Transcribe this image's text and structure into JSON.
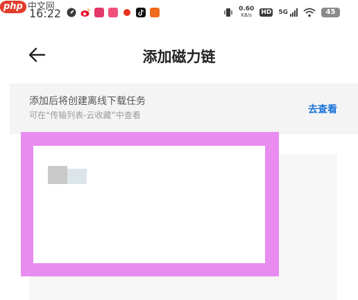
{
  "watermark": {
    "brand": "php",
    "suffix": "中文网"
  },
  "status_bar": {
    "time": "16:22",
    "net_speed_value": "0.60",
    "net_speed_unit": "KB/s",
    "hd_label": "HD",
    "network_label": "5G",
    "battery_level": "45",
    "app_icons": [
      "speedometer-icon",
      "weibo-icon",
      "news-app-icon",
      "app-icon",
      "red-dot-icon",
      "tiktok-icon",
      "notification-app-icon"
    ],
    "colors": {
      "weibo": "#e6162d",
      "news": "#e23a6b",
      "app": "#f0507a",
      "dot": "#e8321f",
      "tiktok": "#111111",
      "notify": "#f26a1b"
    }
  },
  "header": {
    "back_icon": "arrow-left-icon",
    "title": "添加磁力链"
  },
  "notice": {
    "title": "添加后将创建离线下载任务",
    "subtitle": "可在“传输列表-云收藏”中查看",
    "link": "去查看",
    "link_color": "#1a73d9"
  },
  "input": {
    "value": "",
    "highlight_color": "#e98cf0"
  }
}
